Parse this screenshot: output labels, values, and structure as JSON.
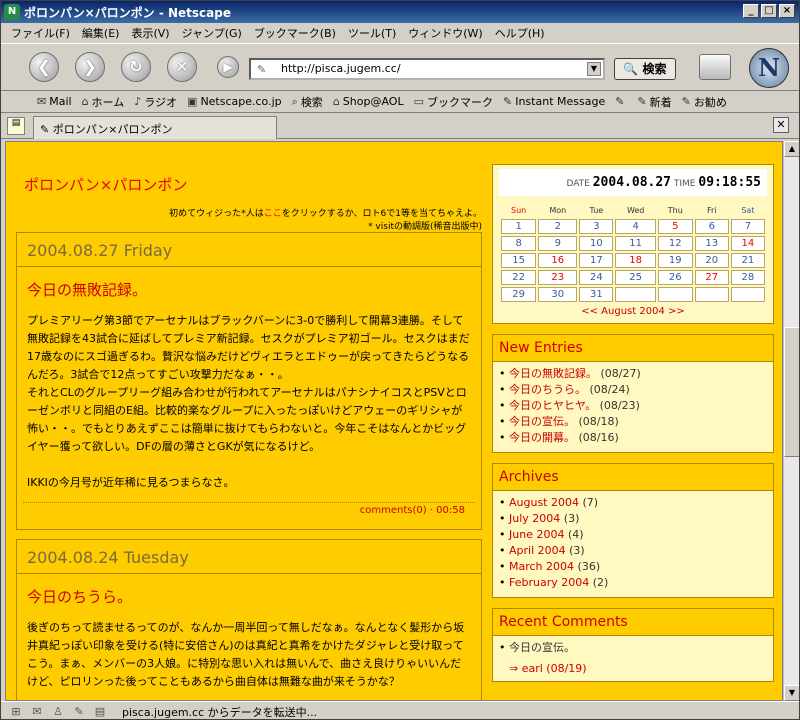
{
  "window": {
    "title": "ポロンパン×パロンポン - Netscape",
    "buttons": [
      "_",
      "□",
      "×"
    ]
  },
  "menu": [
    "ファイル(F)",
    "編集(E)",
    "表示(V)",
    "ジャンプ(G)",
    "ブックマーク(B)",
    "ツール(T)",
    "ウィンドウ(W)",
    "ヘルプ(H)"
  ],
  "nav": {
    "url": "http://pisca.jugem.cc/",
    "search_label": "検索"
  },
  "personal_toolbar": [
    "Mail",
    "ホーム",
    "ラジオ",
    "Netscape.co.jp",
    "検索",
    "Shop@AOL",
    "ブックマーク",
    "Instant Message",
    "",
    "新着",
    "お勧め"
  ],
  "tab": {
    "label": "ポロンパン×パロンポン"
  },
  "page": {
    "site_title": "ポロンパン×パロンポン",
    "sub_line1_pre": "初めてウィジった",
    "sub_line1_mid": "*",
    "sub_line1_link": "ここ",
    "sub_line1_text": "人は",
    "sub_line1_post": "をクリックするか、ロト6で1等を当てちゃえよ。",
    "sub_line2": "* visitの動調版(稀音出版中)",
    "posts": [
      {
        "date": "2004.08.27 Friday",
        "title": "今日の無敗記録。",
        "body": "プレミアリーグ第3節でアーセナルはブラックバーンに3-0で勝利して開幕3連勝。そして無敗記録を43試合に延ばしてプレミア新記録。セスクがプレミア初ゴール。セスクはまだ17歳なのにスゴ過ぎるわ。贅沢な悩みだけどヴィエラとエドゥーが戻ってきたらどうなるんだろ。3試合で12点ってすごい攻撃力だなぁ・・。\nそれとCLのグループリーグ組み合わせが行われてアーセナルはパナシナイコスとPSVとローゼンボリと同組のE組。比較的楽なグループに入ったっぽいけどアウェーのギリシャが怖い・・。でもとりあえずここは簡単に抜けてもらわないと。今年こそはなんとかビッグイヤー獲って欲しい。DFの層の薄さとGKが気になるけど。\n\nIKKIの今月号が近年稀に見るつまらなさ。",
        "footer": "comments(0) · 00:58"
      },
      {
        "date": "2004.08.24 Tuesday",
        "title": "今日のちうら。",
        "body": "後ぎのちって読ませるってのが、なんか一周半回って無しだなぁ。なんとなく髪形から坂井真紀っぽい印象を受ける(特に安倍さん)のは真紀と真希をかけたダジャレと受け取ってこう。まぁ、メンバーの3人娘。に特別な思い入れは無いんで、曲さえ良けりゃいいんだけど、ピロリンった後ってこともあるから曲自体は無難な曲が来そうかな？",
        "footer": ""
      }
    ]
  },
  "calendar": {
    "date_label": "DATE",
    "date": "2004.08.27",
    "time_label": "TIME",
    "time": "09:18:55",
    "weekdays": [
      "Sun",
      "Mon",
      "Tue",
      "Wed",
      "Thu",
      "Fri",
      "Sat"
    ],
    "weeks": [
      [
        "1",
        "2",
        "3",
        "4",
        "5",
        "6",
        "7"
      ],
      [
        "8",
        "9",
        "10",
        "11",
        "12",
        "13",
        "14"
      ],
      [
        "15",
        "16",
        "17",
        "18",
        "19",
        "20",
        "21"
      ],
      [
        "22",
        "23",
        "24",
        "25",
        "26",
        "27",
        "28"
      ],
      [
        "29",
        "30",
        "31",
        "",
        "",
        "",
        ""
      ]
    ],
    "red_days": [
      "5",
      "14",
      "16",
      "18",
      "23",
      "27"
    ],
    "month_nav": "<< August 2004 >>"
  },
  "new_entries": {
    "title": "New Entries",
    "items": [
      {
        "name": "今日の無敗記録。",
        "date": "(08/27)"
      },
      {
        "name": "今日のちうら。",
        "date": "(08/24)"
      },
      {
        "name": "今日のヒヤヒヤ。",
        "date": "(08/23)"
      },
      {
        "name": "今日の宣伝。",
        "date": "(08/18)"
      },
      {
        "name": "今日の開幕。",
        "date": "(08/16)"
      }
    ]
  },
  "archives": {
    "title": "Archives",
    "items": [
      {
        "name": "August 2004",
        "count": "(7)"
      },
      {
        "name": "July 2004",
        "count": "(3)"
      },
      {
        "name": "June 2004",
        "count": "(4)"
      },
      {
        "name": "April 2004",
        "count": "(3)"
      },
      {
        "name": "March 2004",
        "count": "(36)"
      },
      {
        "name": "February 2004",
        "count": "(2)"
      }
    ]
  },
  "recent_comments": {
    "title": "Recent Comments",
    "item": "今日の宣伝。",
    "reply": "⇒ earl (08/19)"
  },
  "status": {
    "text": "pisca.jugem.cc からデータを転送中..."
  }
}
